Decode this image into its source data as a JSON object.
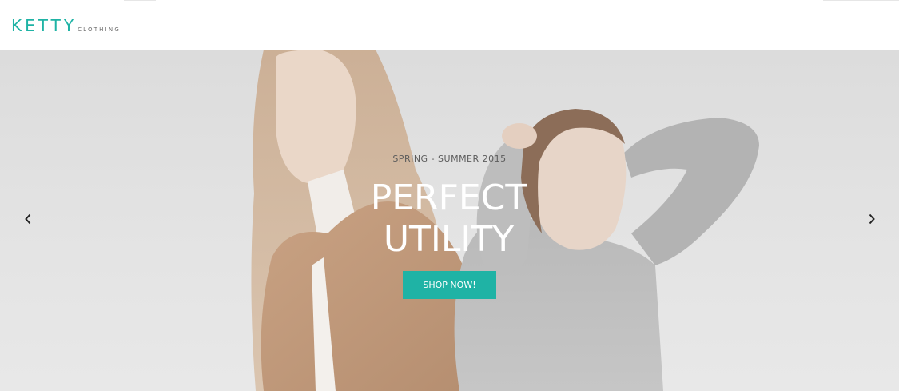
{
  "brand": {
    "name": "KETTY",
    "subtitle": "CLOTHING",
    "accent_color": "#1fb3a5"
  },
  "hero": {
    "season": "SPRING - SUMMER 2015",
    "headline_line1": "PERFECT",
    "headline_line2": "UTILITY",
    "cta_label": "SHOP NOW!",
    "prev_icon": "chevron-left-icon",
    "next_icon": "chevron-right-icon",
    "image_alt": "models-photo"
  }
}
